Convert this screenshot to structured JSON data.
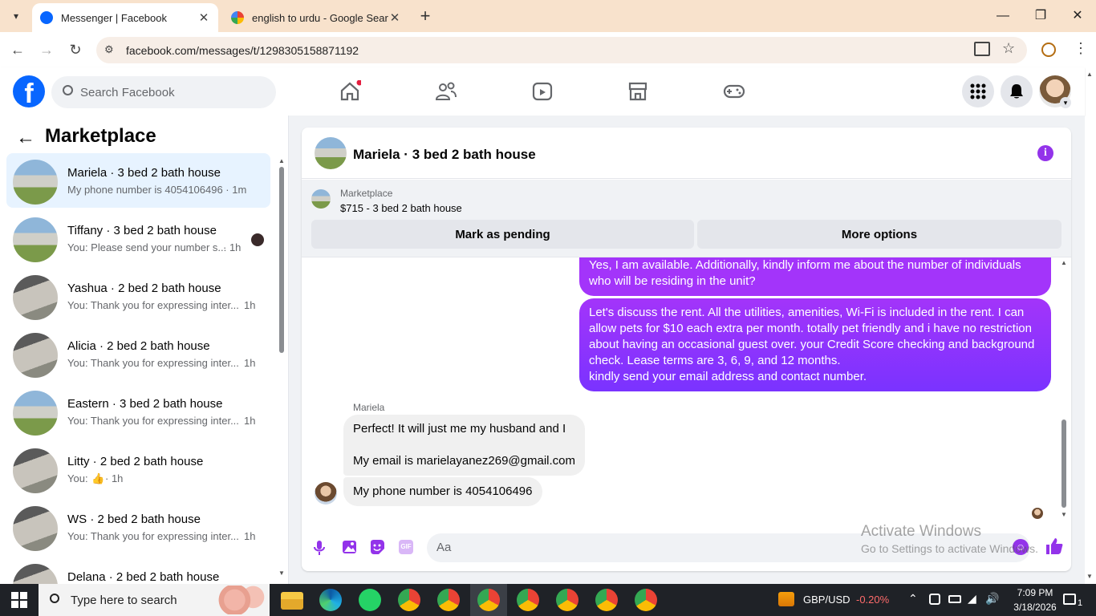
{
  "browser": {
    "tabs": [
      {
        "title": "Messenger | Facebook",
        "active": true
      },
      {
        "title": "english to urdu - Google Search",
        "active": false
      }
    ],
    "new_tab": "+",
    "url": "facebook.com/messages/t/1298305158871192"
  },
  "facebook": {
    "search_placeholder": "Search Facebook",
    "brand_color": "#0866ff"
  },
  "sidebar": {
    "title": "Marketplace",
    "conversations": [
      {
        "name": "Mariela · 3 bed 2 bath house",
        "preview": "My phone number is 4054106496 · 1m",
        "active": true
      },
      {
        "name": "Tiffany · 3 bed 2 bath house",
        "preview": "You: Please send your number s...",
        "time": "· 1h"
      },
      {
        "name": "Yashua · 2 bed 2 bath house",
        "preview": "You: Thank you for expressing inter...",
        "time": "1h"
      },
      {
        "name": "Alicia · 2 bed 2 bath house",
        "preview": "You: Thank you for expressing inter...",
        "time": "1h"
      },
      {
        "name": "Eastern · 3 bed 2 bath house",
        "preview": "You: Thank you for expressing inter...",
        "time": "1h"
      },
      {
        "name": "Litty · 2 bed 2 bath house",
        "preview": "You:",
        "time": "· 1h"
      },
      {
        "name": "WS · 2 bed 2 bath house",
        "preview": "You: Thank you for expressing inter...",
        "time": "1h"
      },
      {
        "name": "Delana · 2 bed 2 bath house",
        "preview": "",
        "time": ""
      }
    ]
  },
  "chat": {
    "header_title": "Mariela · 3 bed 2 bath house",
    "listing_label": "Marketplace",
    "listing_title": "$715 - 3 bed 2 bath house",
    "mark_pending": "Mark as pending",
    "more_options": "More options",
    "messages_out": [
      "Yes, I am available. Additionally, kindly inform me about the number of individuals who will be residing in the unit?",
      "Let's discuss the rent. All the utilities, amenities, Wi-Fi is included in the rent. I can allow pets for $10 each extra per month. totally pet friendly and i have no restriction about having an occasional guest over. your Credit Score checking and background check. Lease terms are 3, 6, 9, and 12 months.\nkindly send your email address and contact number."
    ],
    "sender_name": "Mariela",
    "messages_in": [
      "Perfect!  It will just me my husband and I\n\nMy email is marielayanez269@gmail.com",
      "My phone number is 4054106496"
    ],
    "composer_placeholder": "Aa",
    "accent": "#9333ea"
  },
  "watermark": {
    "line1": "Activate Windows",
    "line2": "Go to Settings to activate Windows."
  },
  "taskbar": {
    "search_placeholder": "Type here to search",
    "ticker": "GBP/USD",
    "ticker_change": "-0.20%",
    "time": "7:09 PM",
    "date": "3/18/2026",
    "notifications": "1"
  }
}
